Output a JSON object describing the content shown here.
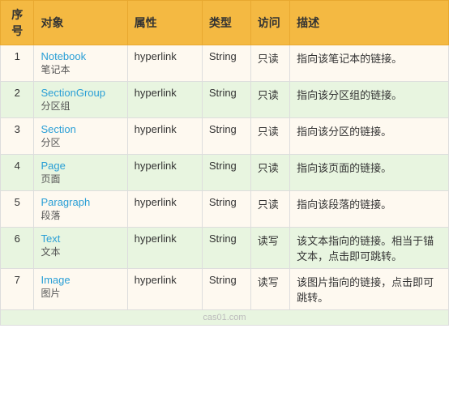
{
  "table": {
    "headers": [
      {
        "key": "seq",
        "label": "序号"
      },
      {
        "key": "obj",
        "label": "对象"
      },
      {
        "key": "attr",
        "label": "属性"
      },
      {
        "key": "type",
        "label": "类型"
      },
      {
        "key": "access",
        "label": "访问"
      },
      {
        "key": "desc",
        "label": "描述"
      }
    ],
    "rows": [
      {
        "seq": "1",
        "obj_main": "Notebook",
        "obj_sub": "笔记本",
        "attr": "hyperlink",
        "type": "String",
        "access": "只读",
        "desc": "指向该笔记本的链接。"
      },
      {
        "seq": "2",
        "obj_main": "SectionGroup",
        "obj_sub": "分区组",
        "attr": "hyperlink",
        "type": "String",
        "access": "只读",
        "desc": "指向该分区组的链接。"
      },
      {
        "seq": "3",
        "obj_main": "Section",
        "obj_sub": "分区",
        "attr": "hyperlink",
        "type": "String",
        "access": "只读",
        "desc": "指向该分区的链接。"
      },
      {
        "seq": "4",
        "obj_main": "Page",
        "obj_sub": "页面",
        "attr": "hyperlink",
        "type": "String",
        "access": "只读",
        "desc": "指向该页面的链接。"
      },
      {
        "seq": "5",
        "obj_main": "Paragraph",
        "obj_sub": "段落",
        "attr": "hyperlink",
        "type": "String",
        "access": "只读",
        "desc": "指向该段落的链接。"
      },
      {
        "seq": "6",
        "obj_main": "Text",
        "obj_sub": "文本",
        "attr": "hyperlink",
        "type": "String",
        "access": "读写",
        "desc": "该文本指向的链接。相当于锚文本，点击即可跳转。"
      },
      {
        "seq": "7",
        "obj_main": "Image",
        "obj_sub": "图片",
        "attr": "hyperlink",
        "type": "String",
        "access": "读写",
        "desc": "该图片指向的链接，点击即可跳转。"
      }
    ],
    "watermark": "cas01.com"
  }
}
